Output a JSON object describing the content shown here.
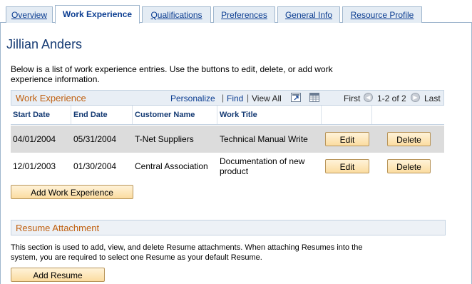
{
  "tabs": [
    {
      "label": "Overview",
      "active": false
    },
    {
      "label": "Work Experience",
      "active": true
    },
    {
      "label": "Qualifications",
      "active": false
    },
    {
      "label": "Preferences",
      "active": false
    },
    {
      "label": "General Info",
      "active": false
    },
    {
      "label": "Resource Profile",
      "active": false
    }
  ],
  "page_title": "Jillian Anders",
  "intro_text": "Below is a list of work experience entries. Use the buttons to edit, delete, or add work experience information.",
  "grid": {
    "title": "Work Experience",
    "personalize": "Personalize",
    "find": "Find",
    "view_all": "View All",
    "first": "First",
    "range": "1-2 of 2",
    "last": "Last",
    "separator": "|",
    "columns": [
      "Start Date",
      "End Date",
      "Customer Name",
      "Work Title"
    ],
    "rows": [
      {
        "start": "04/01/2004",
        "end": "05/31/2004",
        "customer": "T-Net Suppliers",
        "title": "Technical Manual Write"
      },
      {
        "start": "12/01/2003",
        "end": "01/30/2004",
        "customer": "Central Association",
        "title": "Documentation of new product"
      }
    ],
    "edit_label": "Edit",
    "delete_label": "Delete"
  },
  "add_work_button": "Add Work Experience",
  "resume": {
    "title": "Resume Attachment",
    "text": "This section is used to add, view, and delete Resume attachments. When attaching Resumes into the system, you are required to select one Resume as your default Resume.",
    "add_button": "Add Resume"
  },
  "colors": {
    "tab_link": "#0b3d91",
    "section_title": "#c06010",
    "button_fill": "#fbdca0",
    "odd_row": "#dcdcdc"
  },
  "icons": [
    "zoom-window-icon",
    "download-grid-icon",
    "prev-arrow-icon",
    "next-arrow-icon"
  ]
}
